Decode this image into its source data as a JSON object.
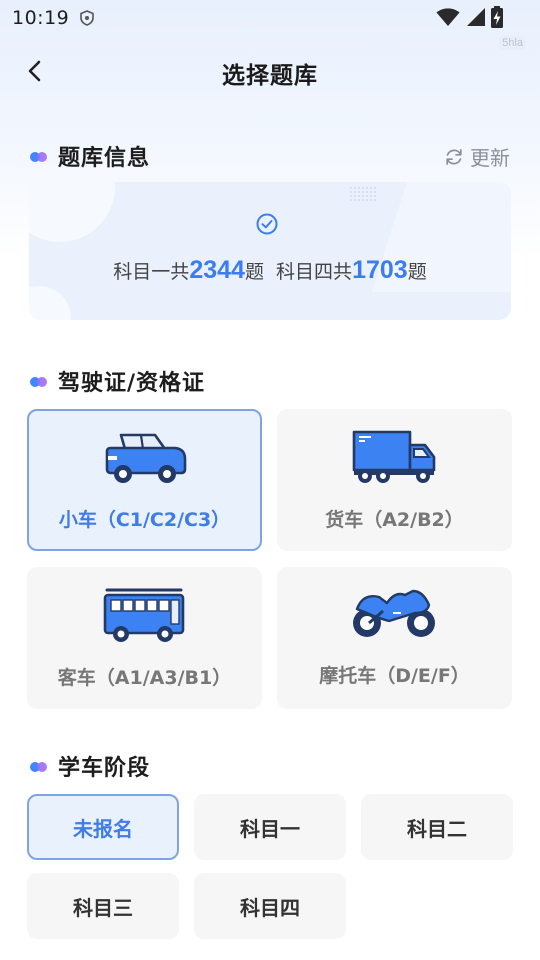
{
  "status_bar": {
    "time": "10:19",
    "icons": [
      "shield-icon",
      "wifi-icon",
      "signal-icon",
      "battery-charging-icon"
    ],
    "watermark": "5hla"
  },
  "nav": {
    "title": "选择题库",
    "back_icon": "chevron-left-icon"
  },
  "bank_info": {
    "title": "题库信息",
    "update_label": "更新",
    "update_icon": "refresh-icon",
    "check_icon": "check-circle-icon",
    "subject1_prefix": "科目一共",
    "subject1_count": "2344",
    "subject1_suffix": "题",
    "subject4_prefix": "科目四共",
    "subject4_count": "1703",
    "subject4_suffix": "题"
  },
  "license": {
    "title": "驾驶证/资格证",
    "options": [
      {
        "label": "小车（C1/C2/C3）",
        "icon": "car-icon",
        "selected": true
      },
      {
        "label": "货车（A2/B2）",
        "icon": "truck-icon",
        "selected": false
      },
      {
        "label": "客车（A1/A3/B1）",
        "icon": "bus-icon",
        "selected": false
      },
      {
        "label": "摩托车（D/E/F）",
        "icon": "motorcycle-icon",
        "selected": false
      }
    ]
  },
  "stage": {
    "title": "学车阶段",
    "options": [
      {
        "label": "未报名",
        "selected": true
      },
      {
        "label": "科目一",
        "selected": false
      },
      {
        "label": "科目二",
        "selected": false
      },
      {
        "label": "科目三",
        "selected": false
      },
      {
        "label": "科目四",
        "selected": false
      }
    ]
  },
  "colors": {
    "accent": "#3f7ce8",
    "selected_bg": "#e9f1fd",
    "selected_border": "#7ea4e3",
    "card_bg": "#f6f6f7",
    "vehicle_blue": "#3d82f3"
  }
}
